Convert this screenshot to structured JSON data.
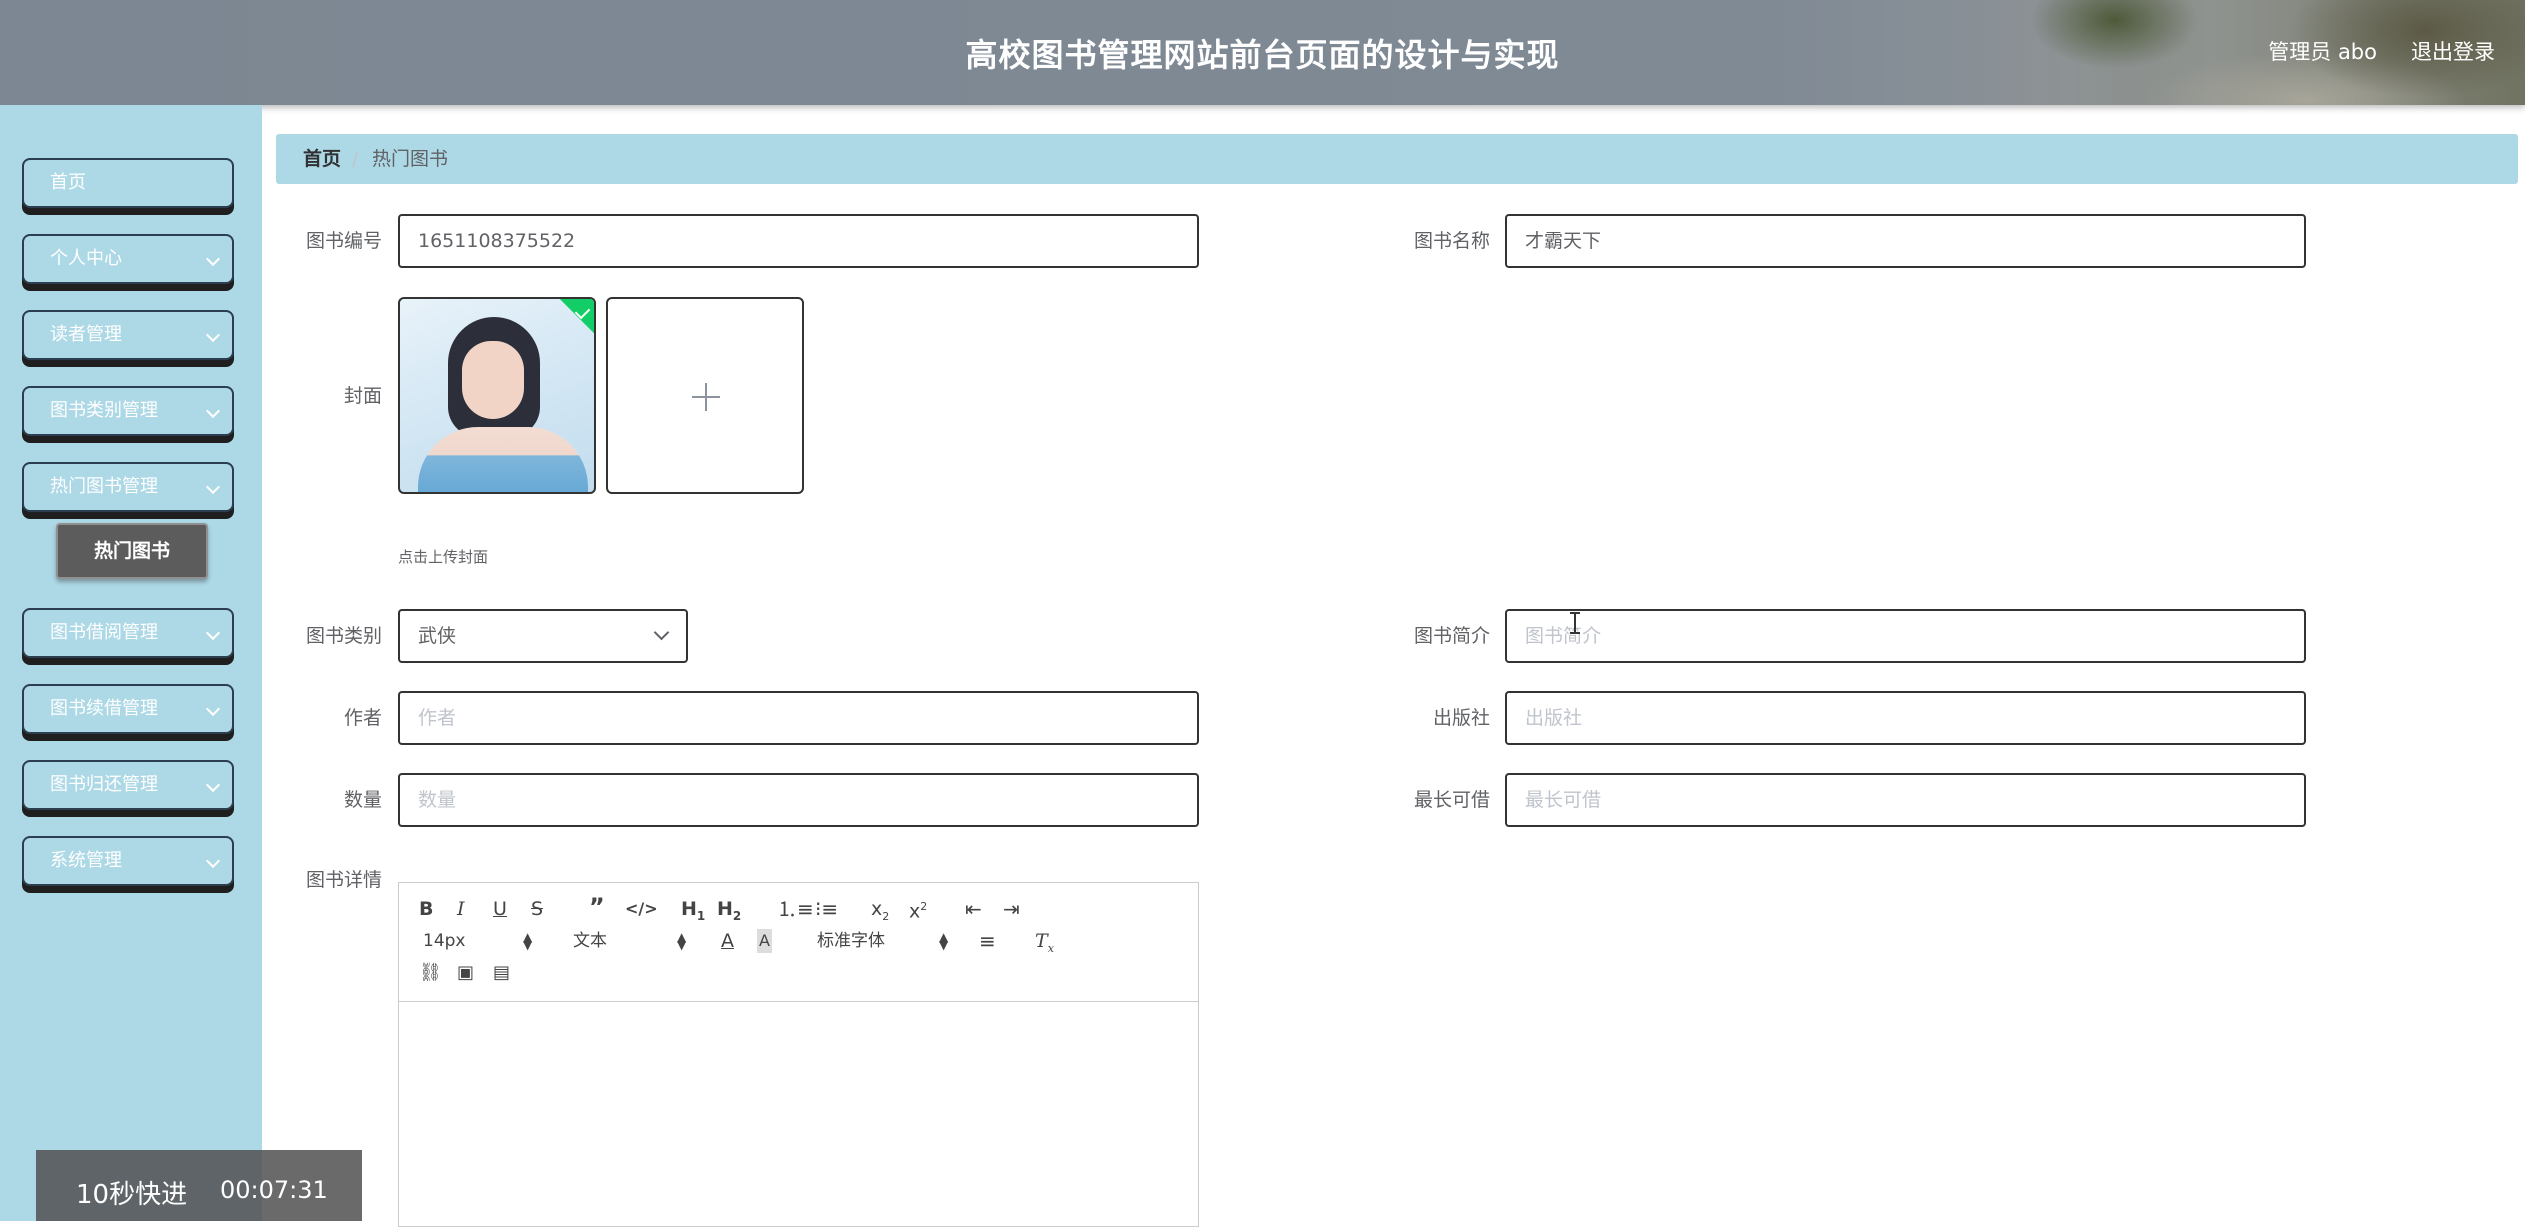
{
  "header": {
    "title": "高校图书管理网站前台页面的设计与实现",
    "user": "管理员 abo",
    "logout": "退出登录"
  },
  "sidebar": {
    "items": [
      {
        "label": "首页",
        "has_chevron": false
      },
      {
        "label": "个人中心",
        "has_chevron": true
      },
      {
        "label": "读者管理",
        "has_chevron": true
      },
      {
        "label": "图书类别管理",
        "has_chevron": true
      },
      {
        "label": "热门图书管理",
        "has_chevron": true
      },
      {
        "label": "图书借阅管理",
        "has_chevron": true
      },
      {
        "label": "图书续借管理",
        "has_chevron": true
      },
      {
        "label": "图书归还管理",
        "has_chevron": true
      },
      {
        "label": "系统管理",
        "has_chevron": true
      }
    ],
    "submenu_active": "热门图书"
  },
  "breadcrumb": {
    "home": "首页",
    "separator": "/",
    "current": "热门图书"
  },
  "form": {
    "book_no": {
      "label": "图书编号",
      "value": "1651108375522"
    },
    "book_name": {
      "label": "图书名称",
      "value": "才霸天下"
    },
    "cover": {
      "label": "封面",
      "tip": "点击上传封面"
    },
    "category": {
      "label": "图书类别",
      "value": "武侠"
    },
    "intro": {
      "label": "图书简介",
      "placeholder": "图书简介"
    },
    "author": {
      "label": "作者",
      "placeholder": "作者"
    },
    "publisher": {
      "label": "出版社",
      "placeholder": "出版社"
    },
    "quantity": {
      "label": "数量",
      "placeholder": "数量"
    },
    "max_borrow": {
      "label": "最长可借",
      "placeholder": "最长可借"
    },
    "detail": {
      "label": "图书详情"
    }
  },
  "editor": {
    "font_size": "14px",
    "block_type": "文本",
    "font_family": "标准字体",
    "icons": [
      "bold-icon",
      "italic-icon",
      "underline-icon",
      "strike-icon",
      "blockquote-icon",
      "code-block-icon",
      "h1-icon",
      "h2-icon",
      "ordered-list-icon",
      "bullet-list-icon",
      "subscript-icon",
      "superscript-icon",
      "outdent-icon",
      "indent-icon",
      "font-color-icon",
      "background-color-icon",
      "align-icon",
      "clear-format-icon",
      "link-icon",
      "image-icon",
      "video-icon"
    ]
  },
  "video": {
    "speed_label": "10秒快进",
    "time": "00:07:31"
  },
  "colors": {
    "sidebar_bg": "#add8e6",
    "header_bg": "#808a95",
    "success": "#13ce66",
    "submenu_bg": "#5c5c5c"
  }
}
